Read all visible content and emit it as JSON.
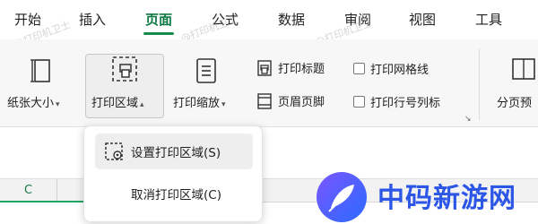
{
  "tabs": [
    {
      "label": "开始",
      "active": false
    },
    {
      "label": "插入",
      "active": false
    },
    {
      "label": "页面",
      "active": true
    },
    {
      "label": "公式",
      "active": false
    },
    {
      "label": "数据",
      "active": false
    },
    {
      "label": "审阅",
      "active": false
    },
    {
      "label": "视图",
      "active": false
    },
    {
      "label": "工具",
      "active": false
    }
  ],
  "ribbon": {
    "paper_size_label": "纸张大小",
    "print_area_label": "打印区域",
    "print_scale_label": "打印缩放",
    "print_title_label": "打印标题",
    "header_footer_label": "页眉页脚",
    "print_gridlines_label": "打印网格线",
    "print_gridlines_checked": false,
    "print_row_col_label": "打印行号列标",
    "print_row_col_checked": false,
    "page_break_preview_label": "分页预"
  },
  "menu": {
    "set_print_area": "设置打印区域(S)",
    "cancel_print_area": "取消打印区域(C)"
  },
  "sheet": {
    "column_label": "C"
  },
  "watermark": {
    "text": "中码新游网",
    "small_text": "@打印机卫士"
  },
  "colors": {
    "accent": "#0f7a43",
    "watermark_blue": "#2c56e6"
  }
}
